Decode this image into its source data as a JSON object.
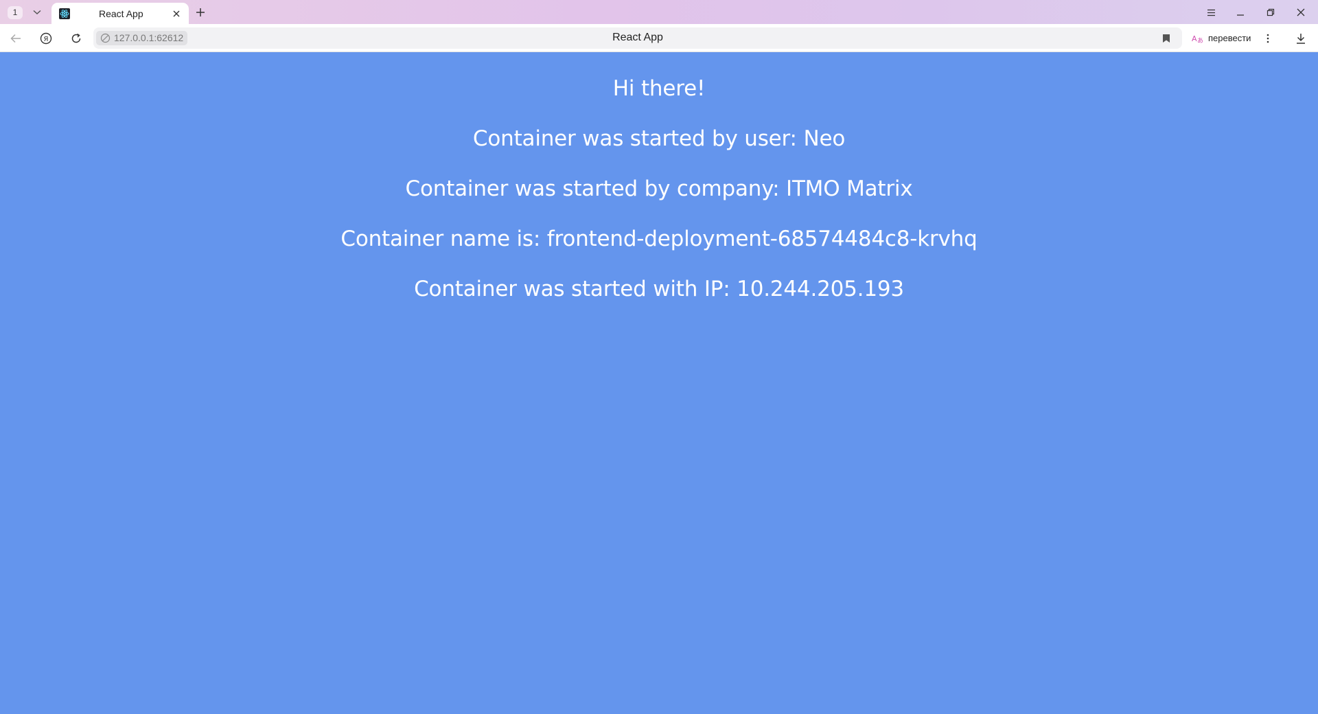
{
  "browser": {
    "tab_count": "1",
    "tab": {
      "title": "React App"
    },
    "address": {
      "url": "127.0.0.1:62612",
      "page_title": "React App"
    },
    "translate_label": "перевести",
    "icons": {
      "tab_list": "chevron-down-icon",
      "favicon": "react-icon",
      "tab_close": "close-icon",
      "new_tab": "plus-icon",
      "menu": "hamburger-icon",
      "minimize": "minimize-icon",
      "restore": "restore-icon",
      "close_window": "close-icon",
      "back": "arrow-left-icon",
      "yandex": "yandex-icon",
      "reload": "reload-icon",
      "site_info": "site-info-icon",
      "bookmark": "bookmark-icon",
      "translate": "translate-icon",
      "more": "more-vertical-icon",
      "downloads": "download-icon"
    }
  },
  "page": {
    "background": "#6495ED",
    "text_color": "#FFFFFF",
    "greeting": "Hi there!",
    "user_line": "Container was started by user: Neo",
    "company_line": "Container was started by company: ITMO Matrix",
    "name_line": "Container name is: frontend-deployment-68574484c8-krvhq",
    "ip_line": "Container was started with IP: 10.244.205.193"
  }
}
